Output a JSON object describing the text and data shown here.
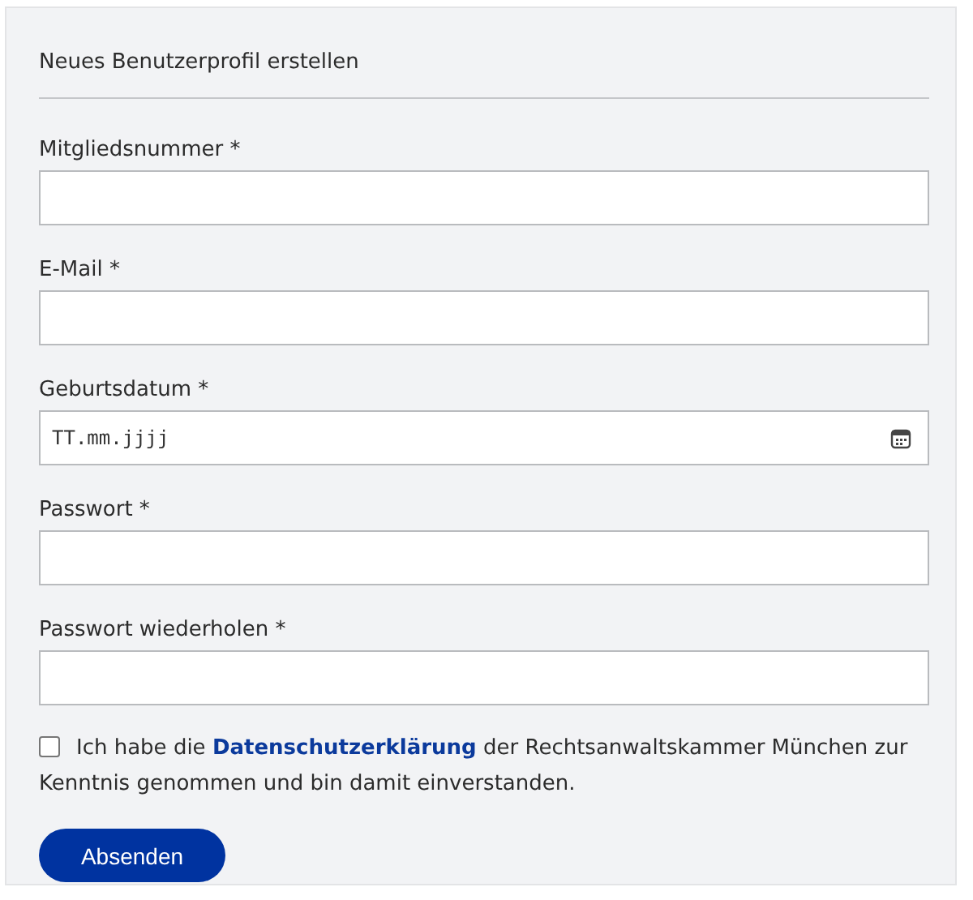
{
  "form": {
    "title": "Neues Benutzerprofil erstellen",
    "fields": [
      {
        "label": "Mitgliedsnummer *",
        "kind": "text"
      },
      {
        "label": "E-Mail *",
        "kind": "text"
      },
      {
        "label": "Geburtsdatum *",
        "kind": "date",
        "placeholder": "TT.mm.jjjj"
      },
      {
        "label": "Passwort *",
        "kind": "text"
      },
      {
        "label": "Passwort wiederholen *",
        "kind": "text"
      }
    ],
    "consent": {
      "checked": false,
      "text_before": "Ich habe die",
      "link": "Datenschutzerklärung",
      "text_after": "der Rechtsanwaltskammer München zur Kenntnis genommen und bin damit einverstanden."
    },
    "submit_button": "Absenden"
  }
}
